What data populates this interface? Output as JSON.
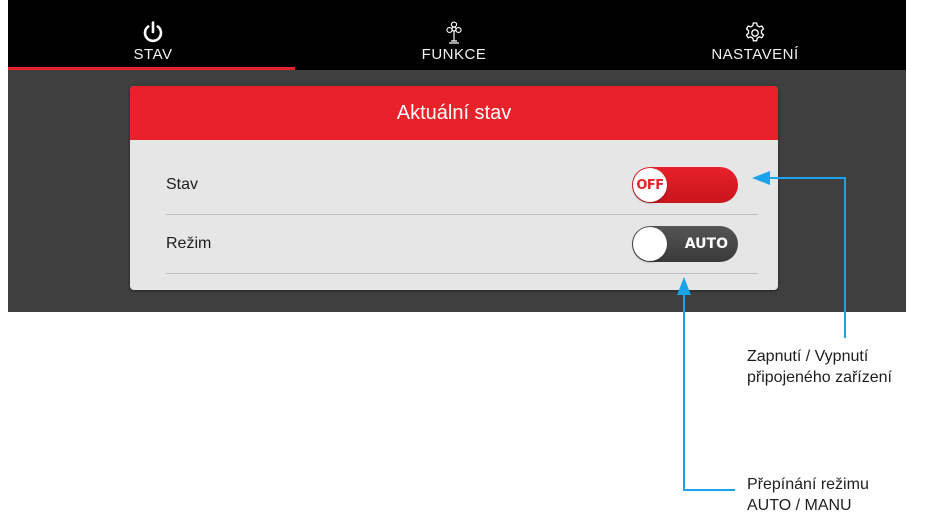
{
  "nav": {
    "tabs": [
      {
        "label": "STAV",
        "icon": "power-icon",
        "active": true
      },
      {
        "label": "FUNKCE",
        "icon": "fan-icon",
        "active": false
      },
      {
        "label": "NASTAVENÍ",
        "icon": "gear-icon",
        "active": false
      }
    ]
  },
  "panel": {
    "title": "Aktuální stav",
    "rows": [
      {
        "label": "Stav",
        "toggle_text": "OFF"
      },
      {
        "label": "Režim",
        "toggle_text": "AUTO"
      }
    ]
  },
  "annotations": {
    "power": {
      "line1": "Zapnutí / Vypnutí",
      "line2": "připojeného zařízení"
    },
    "mode": {
      "line1": "Přepínání režimu",
      "line2": "AUTO / MANU"
    }
  },
  "colors": {
    "accent": "#e8212a",
    "topbar": "#000000",
    "body": "#3f3f3f",
    "panel": "#e6e6e6",
    "callout": "#1aa3e8"
  }
}
